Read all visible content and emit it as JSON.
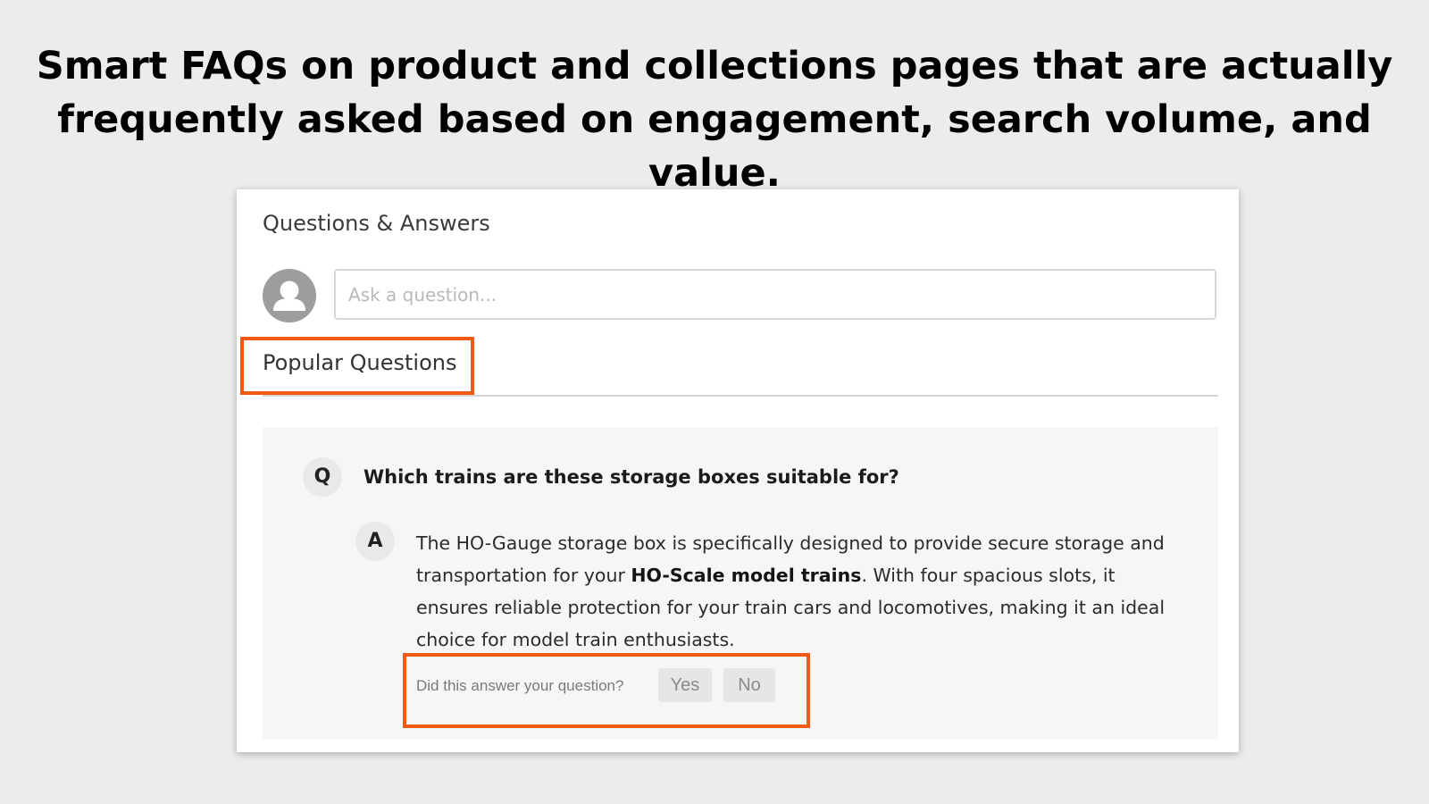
{
  "headline": {
    "line1": "Smart FAQs on product and collections pages that are actually",
    "line2": "frequently asked based on engagement, search volume, and value."
  },
  "qa_widget": {
    "title": "Questions & Answers",
    "ask_placeholder": "Ask a question...",
    "tab_label": "Popular Questions",
    "question_badge": "Q",
    "answer_badge": "A",
    "question": "Which trains are these storage boxes suitable for?",
    "answer": {
      "part1": "The HO-Gauge storage box is specifically designed to provide secure storage and transportation for your ",
      "bold": "HO-Scale model trains",
      "part2": ". With four spacious slots, it ensures reliable protection for your train cars and locomotives, making it an ideal choice for model train enthusiasts."
    },
    "feedback": {
      "prompt": "Did this answer your question?",
      "yes": "Yes",
      "no": "No"
    }
  },
  "colors": {
    "background": "#ececea",
    "highlight": "#f05a14",
    "panel": "#f6f6f6"
  },
  "icons": {
    "avatar": "user-avatar-icon"
  }
}
